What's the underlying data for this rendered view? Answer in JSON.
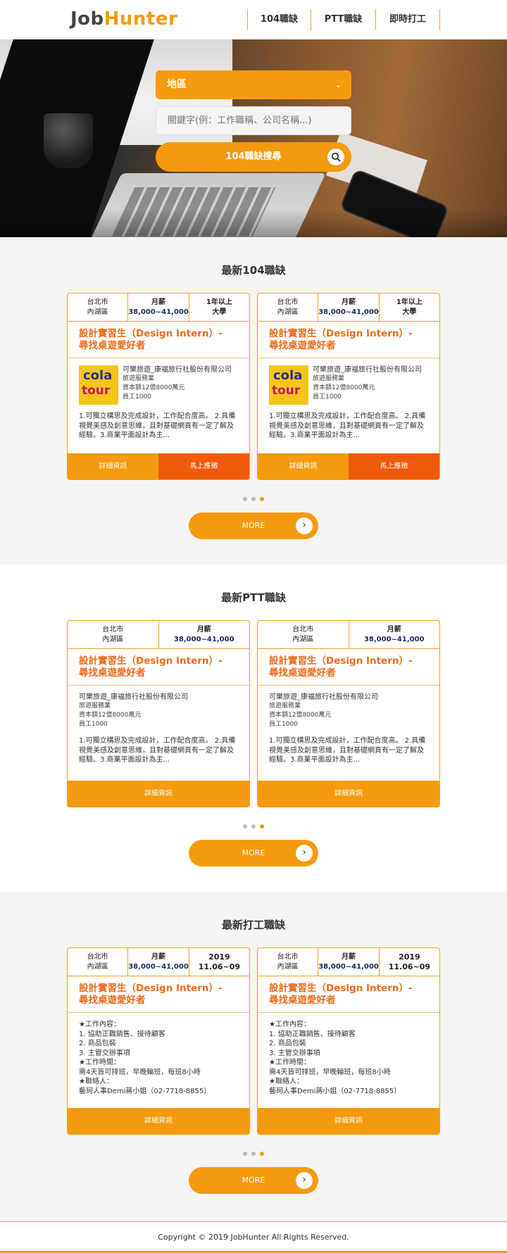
{
  "header": {
    "logo_job": "Job",
    "logo_hunter": "Hunter",
    "nav": [
      "104職缺",
      "PTT職缺",
      "即時打工"
    ]
  },
  "search": {
    "region_label": "地區",
    "keyword_placeholder": "關鍵字(例：工作職稱、公司名稱...)",
    "button_label": "104職缺搜尋"
  },
  "sections": {
    "s104": {
      "title": "最新104職缺",
      "cards": [
        {
          "city": "台北市",
          "district": "內湖區",
          "salary_label": "月薪",
          "salary": "38,000~41,000",
          "exp": "1年以上",
          "edu": "大學",
          "title_line1": "設計實習生（Design Intern）-",
          "title_line2": "尋找桌遊愛好者",
          "logo_top": "cola",
          "logo_bottom": "tour",
          "company": "可樂旅遊_康福旅行社股份有限公司",
          "industry": "旅遊服務業",
          "capital": "資本額12億8000萬元",
          "employees": "員工1000",
          "desc": "1.可獨立構思及完成設計，工作配合度高。 2.具備視覺美感及創意思維，且對基礎網頁有一定了解及經驗。3.商業平面設計為主...",
          "btn_detail": "詳細資訊",
          "btn_apply": "馬上應徵"
        },
        {
          "city": "台北市",
          "district": "內湖區",
          "salary_label": "月薪",
          "salary": "38,000~41,000",
          "exp": "1年以上",
          "edu": "大學",
          "title_line1": "設計實習生（Design Intern）-",
          "title_line2": "尋找桌遊愛好者",
          "logo_top": "cola",
          "logo_bottom": "tour",
          "company": "可樂旅遊_康福旅行社股份有限公司",
          "industry": "旅遊服務業",
          "capital": "資本額12億8000萬元",
          "employees": "員工1000",
          "desc": "1.可獨立構思及完成設計，工作配合度高。 2.具備視覺美感及創意思維，且對基礎網頁有一定了解及經驗。3.商業平面設計為主...",
          "btn_detail": "詳細資訊",
          "btn_apply": "馬上應徵"
        }
      ],
      "more": "MORE"
    },
    "sptt": {
      "title": "最新PTT職缺",
      "cards": [
        {
          "city": "台北市",
          "district": "內湖區",
          "salary_label": "月薪",
          "salary": "38,000~41,000",
          "title_line1": "設計實習生（Design Intern）-",
          "title_line2": "尋找桌遊愛好者",
          "company": "可樂旅遊_康福旅行社股份有限公司",
          "industry": "旅遊服務業",
          "capital": "資本額12億8000萬元",
          "employees": "員工1000",
          "desc": "1.可獨立構思及完成設計，工作配合度高。 2.具備視覺美感及創意思維，且對基礎網頁有一定了解及經驗。3.商業平面設計為主...",
          "btn_detail": "詳細資訊"
        },
        {
          "city": "台北市",
          "district": "內湖區",
          "salary_label": "月薪",
          "salary": "38,000~41,000",
          "title_line1": "設計實習生（Design Intern）-",
          "title_line2": "尋找桌遊愛好者",
          "company": "可樂旅遊_康福旅行社股份有限公司",
          "industry": "旅遊服務業",
          "capital": "資本額12億8000萬元",
          "employees": "員工1000",
          "desc": "1.可獨立構思及完成設計，工作配合度高。 2.具備視覺美感及創意思維，且對基礎網頁有一定了解及經驗。3.商業平面設計為主...",
          "btn_detail": "詳細資訊"
        }
      ],
      "more": "MORE"
    },
    "spart": {
      "title": "最新打工職缺",
      "cards": [
        {
          "city": "台北市",
          "district": "內湖區",
          "salary_label": "月薪",
          "salary": "38,000~41,000",
          "year": "2019",
          "dates": "11.06~09",
          "title_line1": "設計實習生（Design Intern）-",
          "title_line2": "尋找桌遊愛好者",
          "details": "★工作內容：\n1. 協助正職銷售、接待顧客\n2. 商品包裝\n3. 主管交辦事項\n★工作時間：\n需4天皆可排班，早晚輪班，每班8小時\n★聯絡人：\n藝珂人事Demi蔣小姐（02-7718-8855）",
          "btn_detail": "詳細資訊"
        },
        {
          "city": "台北市",
          "district": "內湖區",
          "salary_label": "月薪",
          "salary": "38,000~41,000",
          "year": "2019",
          "dates": "11.06~09",
          "title_line1": "設計實習生（Design Intern）-",
          "title_line2": "尋找桌遊愛好者",
          "details": "★工作內容：\n1. 協助正職銷售、接待顧客\n2. 商品包裝\n3. 主管交辦事項\n★工作時間：\n需4天皆可排班，早晚輪班，每班8小時\n★聯絡人：\n藝珂人事Demi蔣小姐（02-7718-8855）",
          "btn_detail": "詳細資訊"
        }
      ],
      "more": "MORE"
    }
  },
  "footer": {
    "copyright": "Copyright © 2019 JobHunter All Rights Reserved."
  },
  "colors": {
    "accent": "#f59a0c",
    "apply": "#ef5a0b",
    "title": "#ef6a18"
  }
}
